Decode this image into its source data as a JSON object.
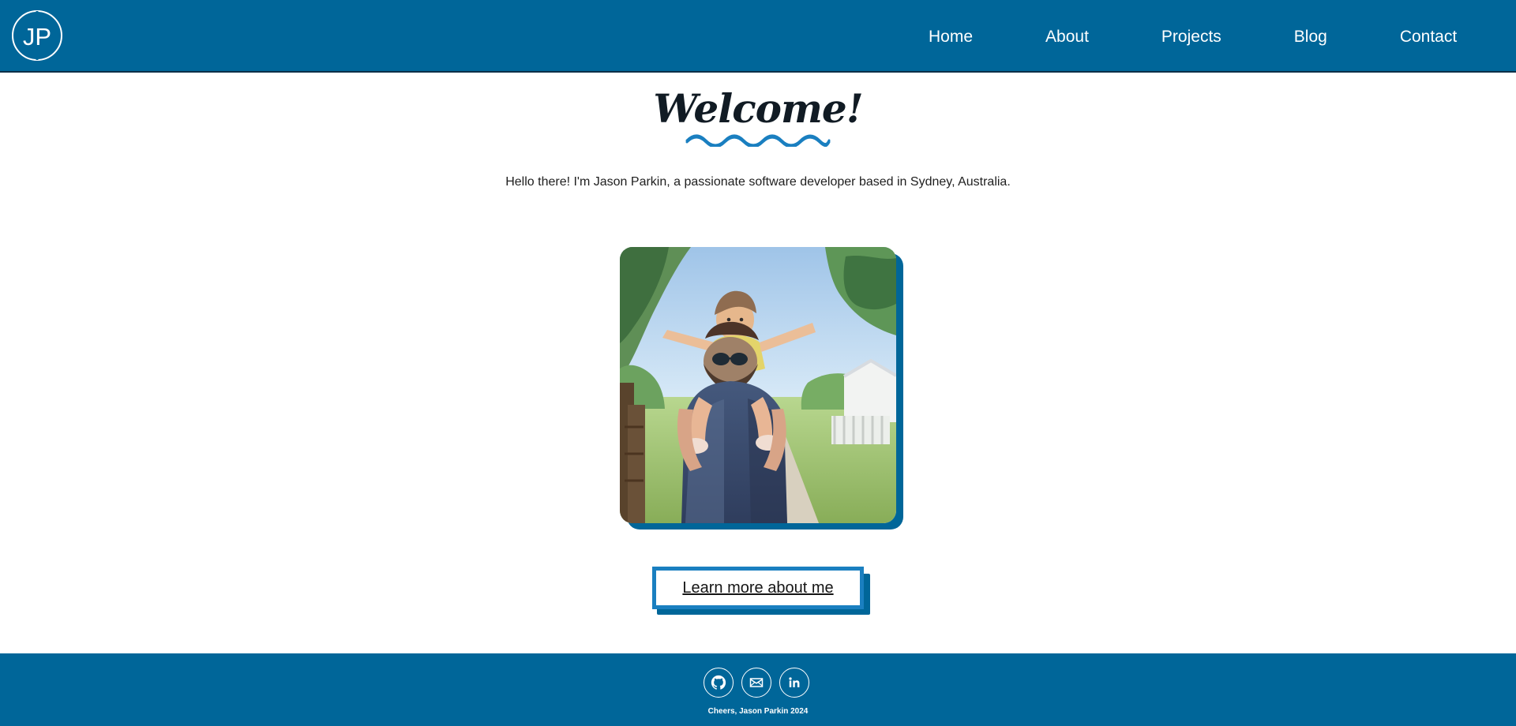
{
  "site": {
    "logo_text": "JP",
    "nav": [
      {
        "label": "Home"
      },
      {
        "label": "About"
      },
      {
        "label": "Projects"
      },
      {
        "label": "Blog"
      },
      {
        "label": "Contact"
      }
    ]
  },
  "main": {
    "title": "Welcome!",
    "intro": "Hello there! I'm Jason Parkin, a passionate software developer based in Sydney, Australia.",
    "cta_label": "Learn more about me"
  },
  "footer": {
    "text": "Cheers, Jason Parkin 2024",
    "icons": [
      "github-icon",
      "mail-icon",
      "linkedin-icon"
    ]
  },
  "colors": {
    "primary": "#006699",
    "accent": "#1a7fc0",
    "text": "#1f1f1f",
    "background": "#ffffff"
  }
}
